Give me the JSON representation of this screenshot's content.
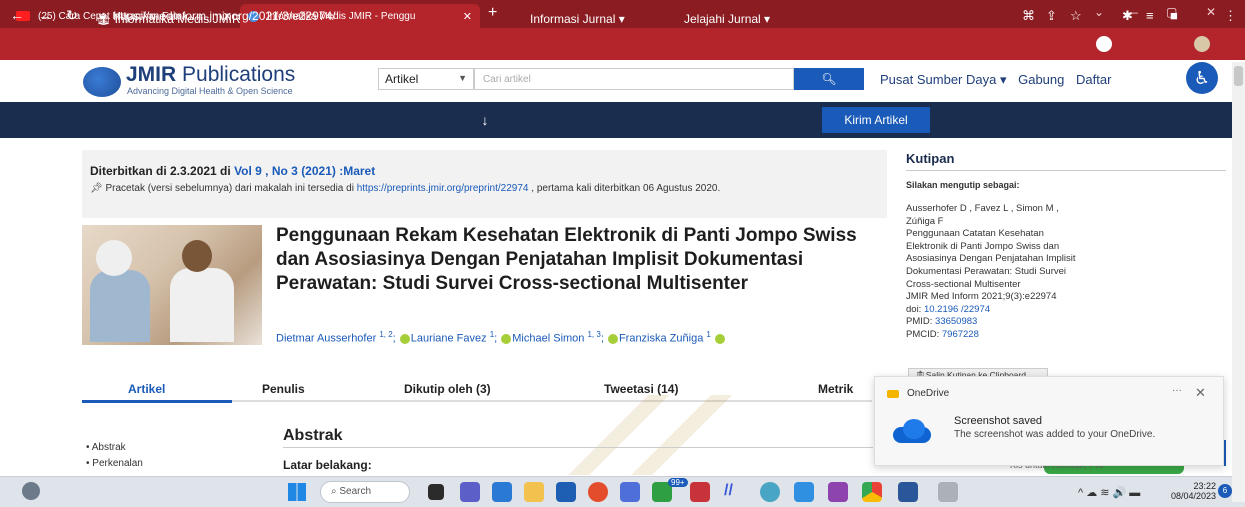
{
  "browser": {
    "tabs": [
      {
        "title": "(25) Cara Cepat Merapikan Foto/",
        "close": "✕",
        "icon_color": "#ff1f1f"
      },
      {
        "title": "Informatika Medis JMIR - Penggu",
        "close": "✕",
        "icon_color": "#4b8fe2"
      }
    ],
    "new_tab": "+",
    "window_controls": [
      "⌄",
      "—",
      "▢",
      "✕"
    ],
    "url": "https://medinform.jmir.org/2021/3/e22974/"
  },
  "site": {
    "logo_bold": "JMIR",
    "logo_rest": " Publications",
    "tagline": "Advancing Digital Health & Open Science",
    "search_scope": "Artikel",
    "search_placeholder": "Cari artikel",
    "search_button_icon": "search-icon",
    "top_links": [
      "Pusat Sumber Daya ▾",
      "Gabung",
      "Daftar"
    ],
    "accessibility_icon": "accessibility-icon"
  },
  "navbar": {
    "home": "Informatika Medis JMIR",
    "info": "Informasi Jurnal ▾",
    "explore": "Jelajahi Jurnal ▾",
    "submit": "Kirim Artikel"
  },
  "publication": {
    "published_prefix": "Diterbitkan di 2.3.2021 di ",
    "issue_link": "Vol 9 , No 3 (2021) :Maret",
    "preprint_text_1": "Pracetak (versi sebelumnya) dari makalah ini tersedia di ",
    "preprint_link": "https://preprints.jmir.org/preprint/22974",
    "preprint_text_2": " , pertama kali diterbitkan 06 Agustus 2020."
  },
  "article": {
    "title": "Penggunaan Rekam Kesehatan Elektronik di Panti Jompo Swiss dan Asosiasinya Dengan Penjatahan Implisit Dokumentasi Perawatan: Studi Survei Cross-sectional Multisenter",
    "authors": [
      {
        "name": "Dietmar Ausserhofer",
        "sup": "1, 2"
      },
      {
        "name": "Lauriane Favez",
        "sup": "1"
      },
      {
        "name": "Michael Simon",
        "sup": "1, 3"
      },
      {
        "name": "Franziska Zuñiga",
        "sup": "1"
      }
    ]
  },
  "article_tabs": [
    "Artikel",
    "Penulis",
    "Dikutip oleh (3)",
    "Tweetasi (14)",
    "Metrik"
  ],
  "toc": [
    "Abstrak",
    "Perkenalan"
  ],
  "abstract": {
    "heading": "Abstrak",
    "sub": "Latar belakang:"
  },
  "citation": {
    "heading": "Kutipan",
    "sub": "Silakan mengutip sebagai:",
    "authors": "Ausserhofer D , Favez L , Simon M , Zúñiga F",
    "title": "Penggunaan Catatan Kesehatan Elektronik di Panti Jompo Swiss dan Asosiasinya Dengan Penjatahan Implisit Dokumentasi Perawatan: Studi Survei Cross-sectional Multisenter",
    "journal": "JMIR Med Inform 2021;9(3):e22974",
    "doi_label": "doi: ",
    "doi": "10.2196 /22974",
    "pmid_label": "PMID: ",
    "pmid": "33650983",
    "pmcid_label": "PMCID: ",
    "pmcid": "7967228",
    "copy_button": "Salin Kutipan ke Clipboard",
    "partial_text": "Kis untuk: Kenwan, Pro"
  },
  "toast": {
    "app": "OneDrive",
    "more": "···",
    "close": "✕",
    "title": "Screenshot saved",
    "body": "The screenshot was added to your OneDrive."
  },
  "taskbar": {
    "search": "Search",
    "badge": "99+",
    "tray": "^ ☁ ≋ 🔊 ▬",
    "time": "23:22",
    "date": "08/04/2023",
    "notifications": "6"
  }
}
